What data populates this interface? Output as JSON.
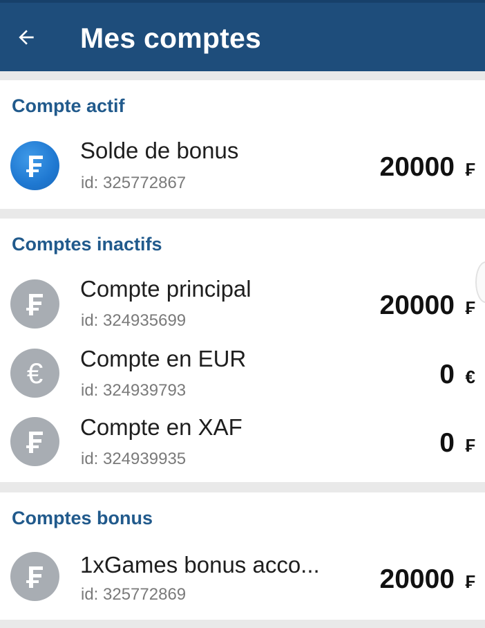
{
  "header": {
    "title": "Mes comptes",
    "back_icon": "arrow-left-icon"
  },
  "colors": {
    "header_bg": "#1e4d7b",
    "section_title": "#215a8c",
    "active_coin": "#1f78d1",
    "inactive_coin": "#a8adb3"
  },
  "sections": {
    "active": {
      "title": "Compte actif",
      "accounts": [
        {
          "name": "Solde de bonus",
          "id": "id: 325772867",
          "amount": "20000",
          "currency": "₣",
          "icon": "franc-coin-icon"
        }
      ]
    },
    "inactive": {
      "title": "Comptes inactifs",
      "accounts": [
        {
          "name": "Compte principal",
          "id": "id: 324935699",
          "amount": "20000",
          "currency": "₣",
          "icon": "franc-coin-icon"
        },
        {
          "name": "Compte en  EUR",
          "id": "id: 324939793",
          "amount": "0",
          "currency": "€",
          "icon": "euro-coin-icon"
        },
        {
          "name": "Compte en  XAF",
          "id": "id: 324939935",
          "amount": "0",
          "currency": "₣",
          "icon": "franc-coin-icon"
        }
      ]
    },
    "bonus": {
      "title": "Comptes bonus",
      "accounts": [
        {
          "name": "1xGames bonus acco...",
          "id": "id: 325772869",
          "amount": "20000",
          "currency": "₣",
          "icon": "franc-coin-icon"
        }
      ]
    }
  }
}
